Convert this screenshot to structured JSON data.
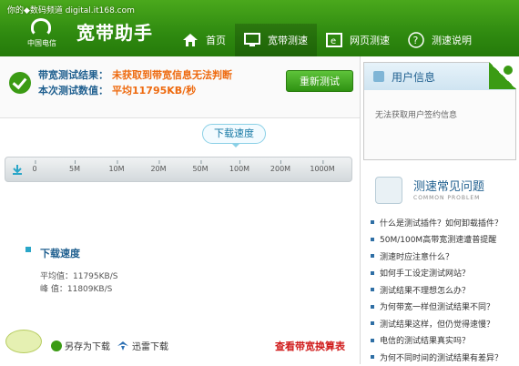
{
  "watermark": "你的◆数码频道 digital.it168.com",
  "header": {
    "logo_text": "中国电信",
    "title": "宽带助手",
    "nav": [
      {
        "label": "首页",
        "icon": "home-icon"
      },
      {
        "label": "宽带测速",
        "icon": "monitor-icon"
      },
      {
        "label": "网页测速",
        "icon": "browser-icon"
      },
      {
        "label": "测速说明",
        "icon": "help-icon"
      }
    ]
  },
  "result": {
    "label1": "带宽测试结果：",
    "value1": "未获取到带宽信息无法判断",
    "label2": "本次测试数值：",
    "value2": "平均11795KB/秒",
    "retest": "重新测试"
  },
  "scale": {
    "tag": "下载速度",
    "ticks": [
      "0",
      "5M",
      "10M",
      "20M",
      "50M",
      "100M",
      "200M",
      "1000M"
    ]
  },
  "download": {
    "title": "下载速度",
    "avg": "平均值：11795KB/S",
    "peak": "峰  值：11809KB/S"
  },
  "bottom": {
    "save": "另存为下载",
    "thunder": "迅雷下载",
    "calc": "查看带宽换算表"
  },
  "user_panel": {
    "title": "用户信息",
    "info": "无法获取用户签约信息"
  },
  "faq": {
    "title": "测速常见问题",
    "subtitle": "COMMON PROBLEM",
    "items": [
      "什么是测试插件？如何卸载插件？",
      "50M/100M高带宽测速遭普提醒",
      "测速时应注意什么？",
      "如何手工设定测试网站？",
      "测试结果不理想怎么办？",
      "为何带宽一样但测试结果不同？",
      "测试结果这样，但仍觉得速慢？",
      "电信的测试结果真实吗？",
      "为何不同时间的测试结果有差异？"
    ]
  },
  "colors": {
    "header_green": "#2f8a10",
    "accent_orange": "#ee6a0f",
    "link_red": "#d01c1c",
    "title_blue": "#1f5f8f"
  }
}
